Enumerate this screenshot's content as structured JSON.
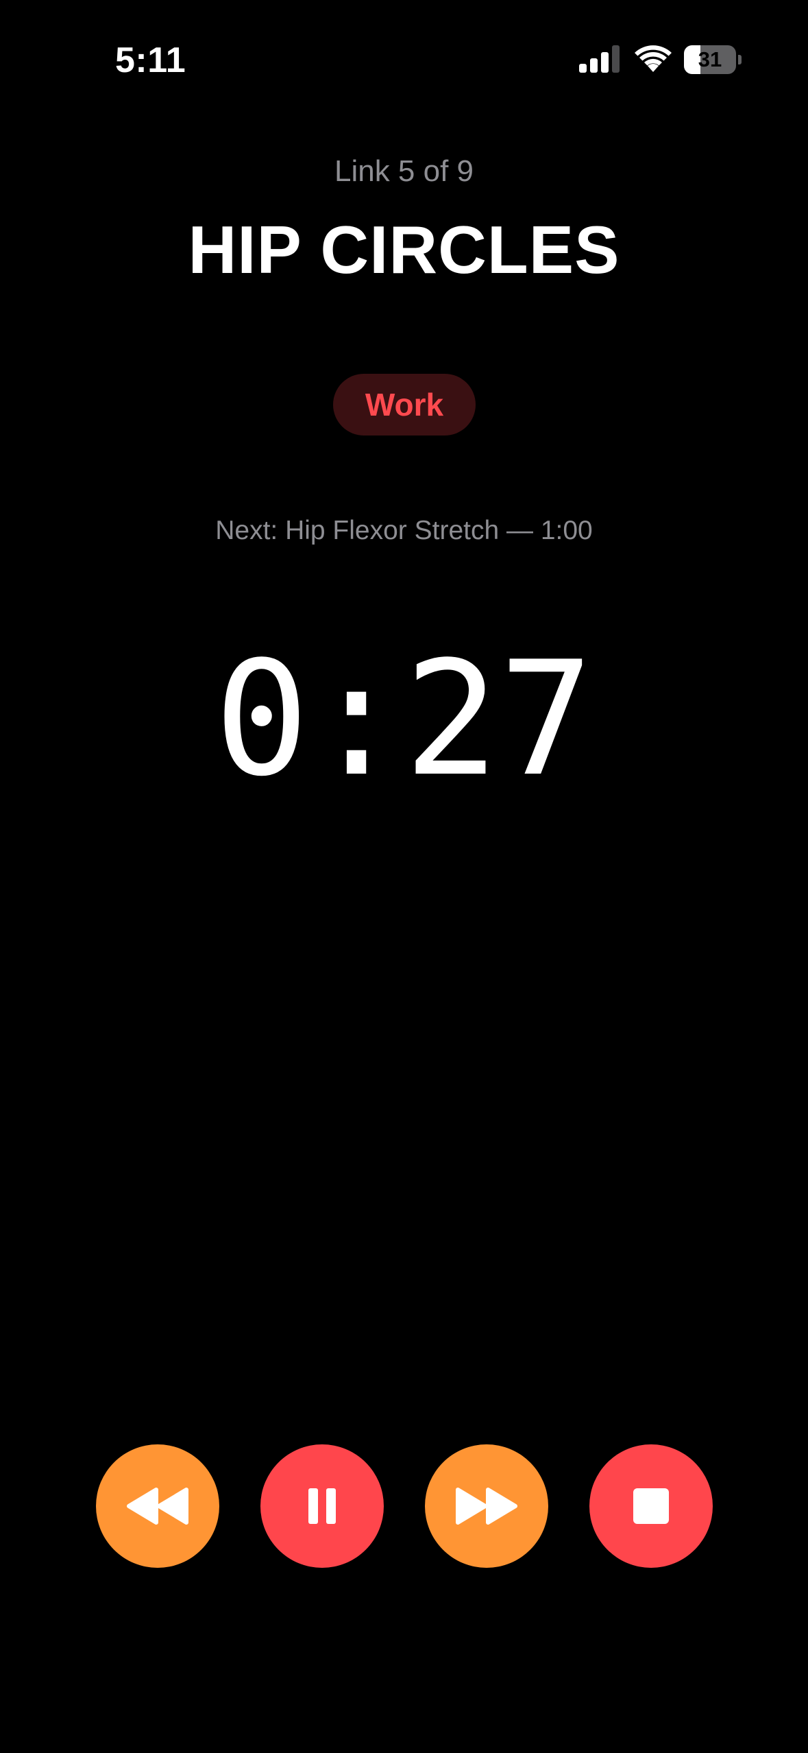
{
  "status_bar": {
    "time": "5:11",
    "signal_bars_active": 3,
    "signal_bars_total": 4,
    "battery_level": "31",
    "battery_fraction": 0.31
  },
  "workout": {
    "link_counter": "Link 5 of 9",
    "exercise_name": "HIP CIRCLES",
    "phase": "Work",
    "next_up": "Next: Hip Flexor Stretch — 1:00",
    "timer": "0:27"
  },
  "controls": {
    "rewind_icon": "rewind-icon",
    "pause_icon": "pause-icon",
    "forward_icon": "fast-forward-icon",
    "stop_icon": "stop-icon"
  },
  "colors": {
    "background": "#000000",
    "accent_orange": "#ff9534",
    "accent_red": "#ff464c",
    "badge_bg": "#3a1012",
    "badge_text": "#ff4a4f",
    "secondary_text": "#8e8e93"
  }
}
